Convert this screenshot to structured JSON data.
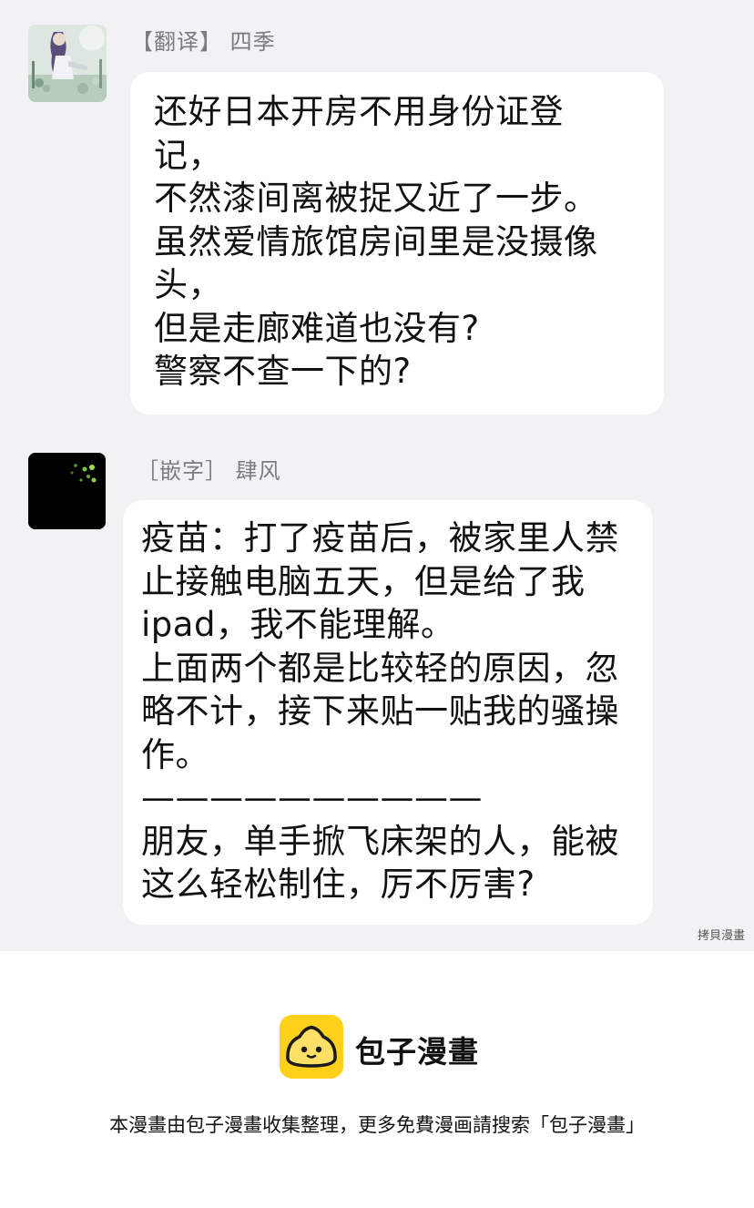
{
  "messages": [
    {
      "sender": "【翻译】 四季",
      "lines": [
        "还好日本开房不用身份证登",
        "记，",
        "不然漆间离被捉又近了一步。",
        "虽然爱情旅馆房间里是没摄像",
        "头，",
        "但是走廊难道也没有?",
        "警察不查一下的?"
      ]
    },
    {
      "sender": "［嵌字］ 肆风",
      "lines": [
        "疫苗：打了疫苗后，被家里人禁",
        "止接触电脑五天，但是给了我",
        "ipad，我不能理解。",
        "上面两个都是比较轻的原因，忽",
        "略不计，接下来贴一贴我的骚操",
        "作。",
        "——————————",
        "朋友，单手掀飞床架的人，能被",
        "这么轻松制住，厉不厉害?"
      ]
    }
  ],
  "watermark": "拷貝漫畫",
  "footer": {
    "brand_name": "包子漫畫",
    "notice": "本漫畫由包子漫畫收集整理，更多免費漫画請搜索「包子漫畫」"
  },
  "colors": {
    "chat_background": "#f2f2f4",
    "bubble": "#ffffff",
    "logo": "#ffd11a"
  },
  "icons": {
    "avatar_1": "anime-illustration-avatar",
    "avatar_2": "dark-fireflies-avatar",
    "logo": "bun-mascot-logo"
  }
}
